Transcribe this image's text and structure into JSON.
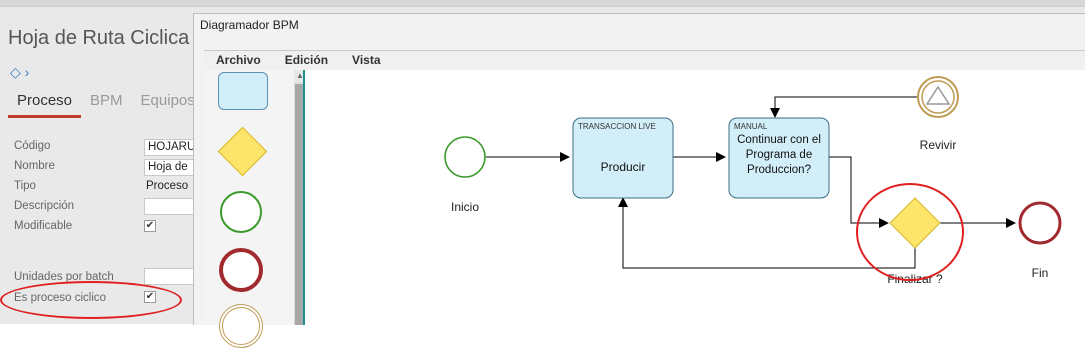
{
  "background_form": {
    "page_title": "Hoja de Ruta Ciclica",
    "tabs": [
      {
        "label": "Proceso",
        "active": true
      },
      {
        "label": "BPM",
        "active": false
      },
      {
        "label": "Equipos",
        "active": false
      }
    ],
    "fields": {
      "codigo": {
        "label": "Código",
        "value": "HOJARU"
      },
      "nombre": {
        "label": "Nombre",
        "value": "Hoja de"
      },
      "tipo": {
        "label": "Tipo",
        "value": "Proceso"
      },
      "descripcion": {
        "label": "Descripción",
        "value": ""
      },
      "modificable": {
        "label": "Modificable",
        "checked": true
      },
      "unidades": {
        "label": "Unidades por batch",
        "value": ""
      },
      "ciclico": {
        "label": "Es proceso ciclico",
        "checked": true
      }
    },
    "check_mark": "✔"
  },
  "bpm_window": {
    "title": "Diagramador BPM",
    "menu": [
      "Archivo",
      "Edición",
      "Vista"
    ],
    "palette": [
      "task-shape",
      "gateway-shape",
      "start-event-shape",
      "end-event-shape",
      "intermediate-event-shape"
    ],
    "nodes": {
      "inicio": {
        "label": "Inicio"
      },
      "producir": {
        "type_label": "TRANSACCION LIVE",
        "label": "Producir"
      },
      "continuar": {
        "type_label": "MANUAL",
        "label_lines": [
          "Continuar con el",
          "Programa de",
          "Produccion?"
        ]
      },
      "revivir": {
        "label": "Revivir"
      },
      "finalizar": {
        "label": "Finalizar ?"
      },
      "fin": {
        "label": "Fin"
      }
    }
  },
  "colors": {
    "task_fill": "#d2eef9",
    "task_stroke": "#3d6d87",
    "gateway_fill": "#fde46b",
    "gateway_stroke": "#d5b92b",
    "start_stroke": "#3c9a2c",
    "end_stroke": "#a12a2e",
    "intermediate_stroke": "#bf9b53",
    "annotation_red": "#e02020",
    "accent_teal": "#1d8f8f"
  }
}
